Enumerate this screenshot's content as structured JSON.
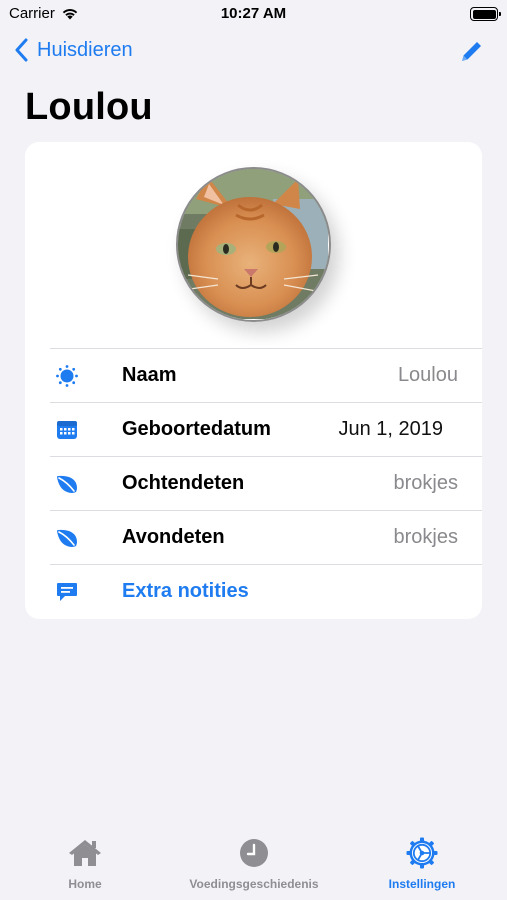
{
  "status_bar": {
    "carrier": "Carrier",
    "time": "10:27 AM"
  },
  "nav": {
    "back_label": "Huisdieren",
    "title": "Loulou"
  },
  "colors": {
    "accent": "#1e7cf0",
    "background": "#f2f2f7",
    "secondary_text": "#8a8a8e"
  },
  "pet": {
    "photo_alt": "Loulou",
    "rows": [
      {
        "icon": "sun-icon",
        "label": "Naam",
        "value": "Loulou"
      },
      {
        "icon": "calendar-icon",
        "label": "Geboortedatum",
        "value": "Jun 1, 2019"
      },
      {
        "icon": "leaf-icon",
        "label": "Ochtendeten",
        "value": "brokjes"
      },
      {
        "icon": "leaf-icon",
        "label": "Avondeten",
        "value": "brokjes"
      }
    ],
    "notes_link": "Extra notities"
  },
  "tabs": [
    {
      "icon": "house-icon",
      "label": "Home",
      "active": false
    },
    {
      "icon": "clock-icon",
      "label": "Voedingsgeschiedenis",
      "active": false
    },
    {
      "icon": "gear-icon",
      "label": "Instellingen",
      "active": true
    }
  ]
}
